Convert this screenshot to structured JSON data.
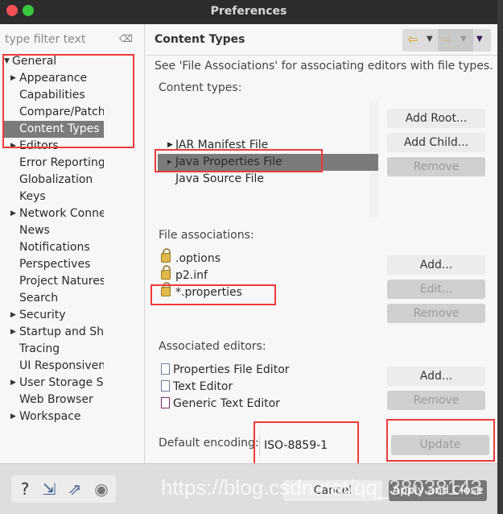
{
  "window": {
    "title": "Preferences"
  },
  "filter": {
    "placeholder": "type filter text",
    "clear_icon": "clear-icon"
  },
  "tree": [
    {
      "label": "General",
      "expanded": true,
      "level": 0
    },
    {
      "label": "Appearance",
      "arrow": true,
      "level": 1
    },
    {
      "label": "Capabilities",
      "level": 1
    },
    {
      "label": "Compare/Patch",
      "level": 1
    },
    {
      "label": "Content Types",
      "level": 1,
      "selected": true
    },
    {
      "label": "Editors",
      "arrow": true,
      "level": 1
    },
    {
      "label": "Error Reporting",
      "level": 1
    },
    {
      "label": "Globalization",
      "level": 1
    },
    {
      "label": "Keys",
      "level": 1
    },
    {
      "label": "Network Conne",
      "arrow": true,
      "level": 1
    },
    {
      "label": "News",
      "level": 1
    },
    {
      "label": "Notifications",
      "level": 1
    },
    {
      "label": "Perspectives",
      "level": 1
    },
    {
      "label": "Project Natures",
      "level": 1
    },
    {
      "label": "Search",
      "level": 1
    },
    {
      "label": "Security",
      "arrow": true,
      "level": 1
    },
    {
      "label": "Startup and Shu",
      "arrow": true,
      "level": 1
    },
    {
      "label": "Tracing",
      "level": 1
    },
    {
      "label": "UI Responsiven",
      "level": 1
    },
    {
      "label": "User Storage Se",
      "arrow": true,
      "level": 1
    },
    {
      "label": "Web Browser",
      "level": 1
    },
    {
      "label": "Workspace",
      "arrow": true,
      "level": 1
    }
  ],
  "page": {
    "title": "Content Types",
    "description": "See 'File Associations' for associating editors with file types.",
    "content_types_label": "Content types:",
    "content_types": [
      "JAR Manifest File",
      "Java Properties File",
      "Java Source File"
    ],
    "content_buttons": {
      "add_root": "Add Root...",
      "add_child": "Add Child...",
      "remove": "Remove"
    },
    "file_assoc_label": "File associations:",
    "file_assocs": [
      ".options",
      "p2.inf",
      "*.properties"
    ],
    "file_buttons": {
      "add": "Add...",
      "edit": "Edit...",
      "remove": "Remove"
    },
    "editors_label": "Associated editors:",
    "editors": [
      "Properties File Editor",
      "Text Editor",
      "Generic Text Editor"
    ],
    "editor_buttons": {
      "add": "Add...",
      "remove": "Remove"
    },
    "encoding_label": "Default encoding:",
    "encoding_value": "ISO-8859-1",
    "update": "Update"
  },
  "footer": {
    "cancel": "Cancel",
    "apply_close": "Apply and Close"
  },
  "watermark": "https://blog.csdn.net/qq_38038143",
  "colors": {
    "selection": "#7b7b7b",
    "annotation": "#f03a3a",
    "titlebar": "#2c2c2c"
  }
}
